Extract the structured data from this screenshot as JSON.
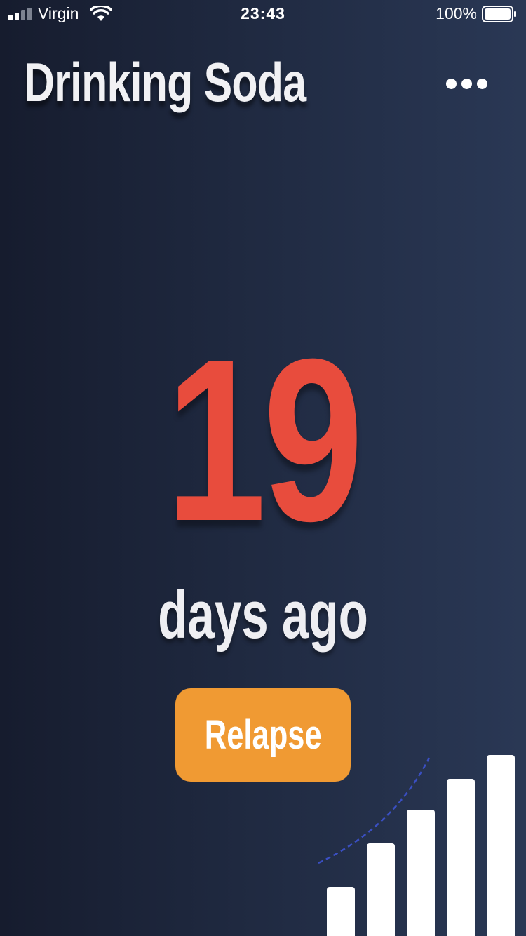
{
  "status_bar": {
    "carrier": "Virgin",
    "time": "23:43",
    "battery": "100%"
  },
  "header": {
    "title": "Drinking Soda",
    "more_icon": "more-horizontal-icon"
  },
  "counter": {
    "value": "19",
    "unit": "days ago"
  },
  "actions": {
    "relapse_label": "Relapse"
  },
  "colors": {
    "counter": "#e84c3d",
    "button": "#f09a33",
    "background_start": "#161c2e",
    "background_end": "#2a3855",
    "decor_curve": "#3a4fc2"
  },
  "decoration": {
    "type": "ascending-bars-icon",
    "bars": 5
  }
}
